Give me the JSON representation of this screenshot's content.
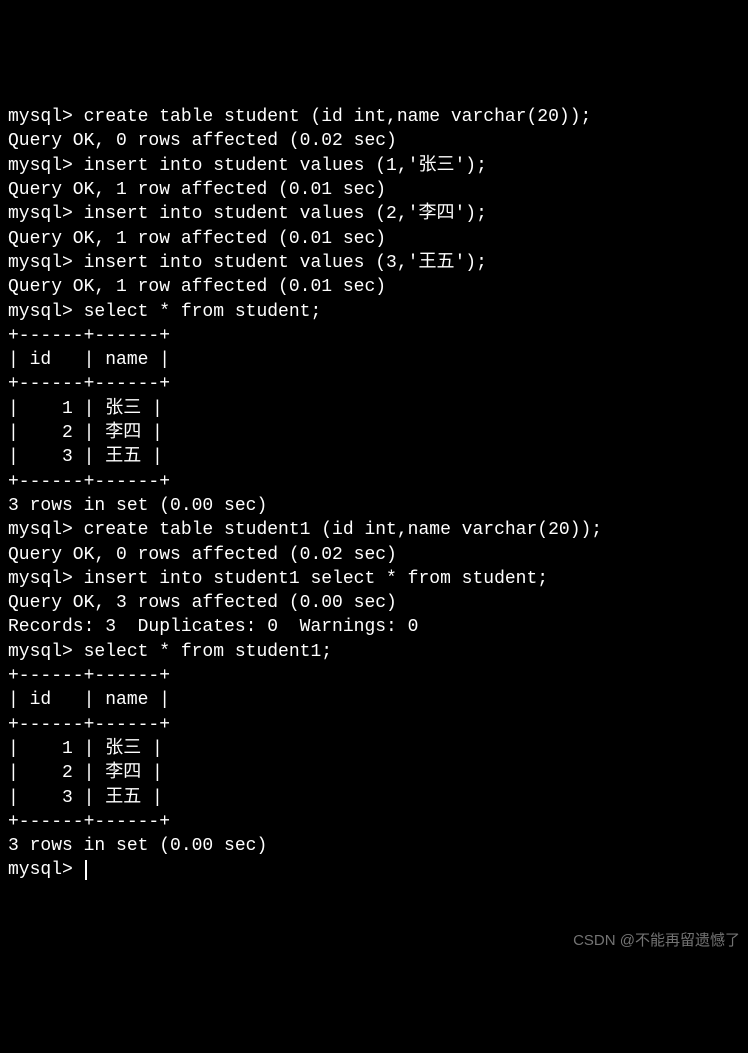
{
  "prompt": "mysql>",
  "lines": {
    "l1": "mysql> create table student (id int,name varchar(20));",
    "l2": "Query OK, 0 rows affected (0.02 sec)",
    "l3": "",
    "l4": "mysql> insert into student values (1,'张三');",
    "l5": "Query OK, 1 row affected (0.01 sec)",
    "l6": "",
    "l7": "mysql> insert into student values (2,'李四');",
    "l8": "Query OK, 1 row affected (0.01 sec)",
    "l9": "",
    "l10": "mysql> insert into student values (3,'王五');",
    "l11": "Query OK, 1 row affected (0.01 sec)",
    "l12": "",
    "l13": "mysql> select * from student;",
    "l14": "+------+------+",
    "l15": "| id   | name |",
    "l16": "+------+------+",
    "l17": "|    1 | 张三 |",
    "l18": "|    2 | 李四 |",
    "l19": "|    3 | 王五 |",
    "l20": "+------+------+",
    "l21": "3 rows in set (0.00 sec)",
    "l22": "",
    "l23": "mysql> create table student1 (id int,name varchar(20));",
    "l24": "Query OK, 0 rows affected (0.02 sec)",
    "l25": "",
    "l26": "mysql> insert into student1 select * from student;",
    "l27": "Query OK, 3 rows affected (0.00 sec)",
    "l28": "Records: 3  Duplicates: 0  Warnings: 0",
    "l29": "",
    "l30": "mysql> select * from student1;",
    "l31": "+------+------+",
    "l32": "| id   | name |",
    "l33": "+------+------+",
    "l34": "|    1 | 张三 |",
    "l35": "|    2 | 李四 |",
    "l36": "|    3 | 王五 |",
    "l37": "+------+------+",
    "l38": "3 rows in set (0.00 sec)",
    "l39": "",
    "l40": "mysql> "
  },
  "watermark": "CSDN @不能再留遗憾了"
}
